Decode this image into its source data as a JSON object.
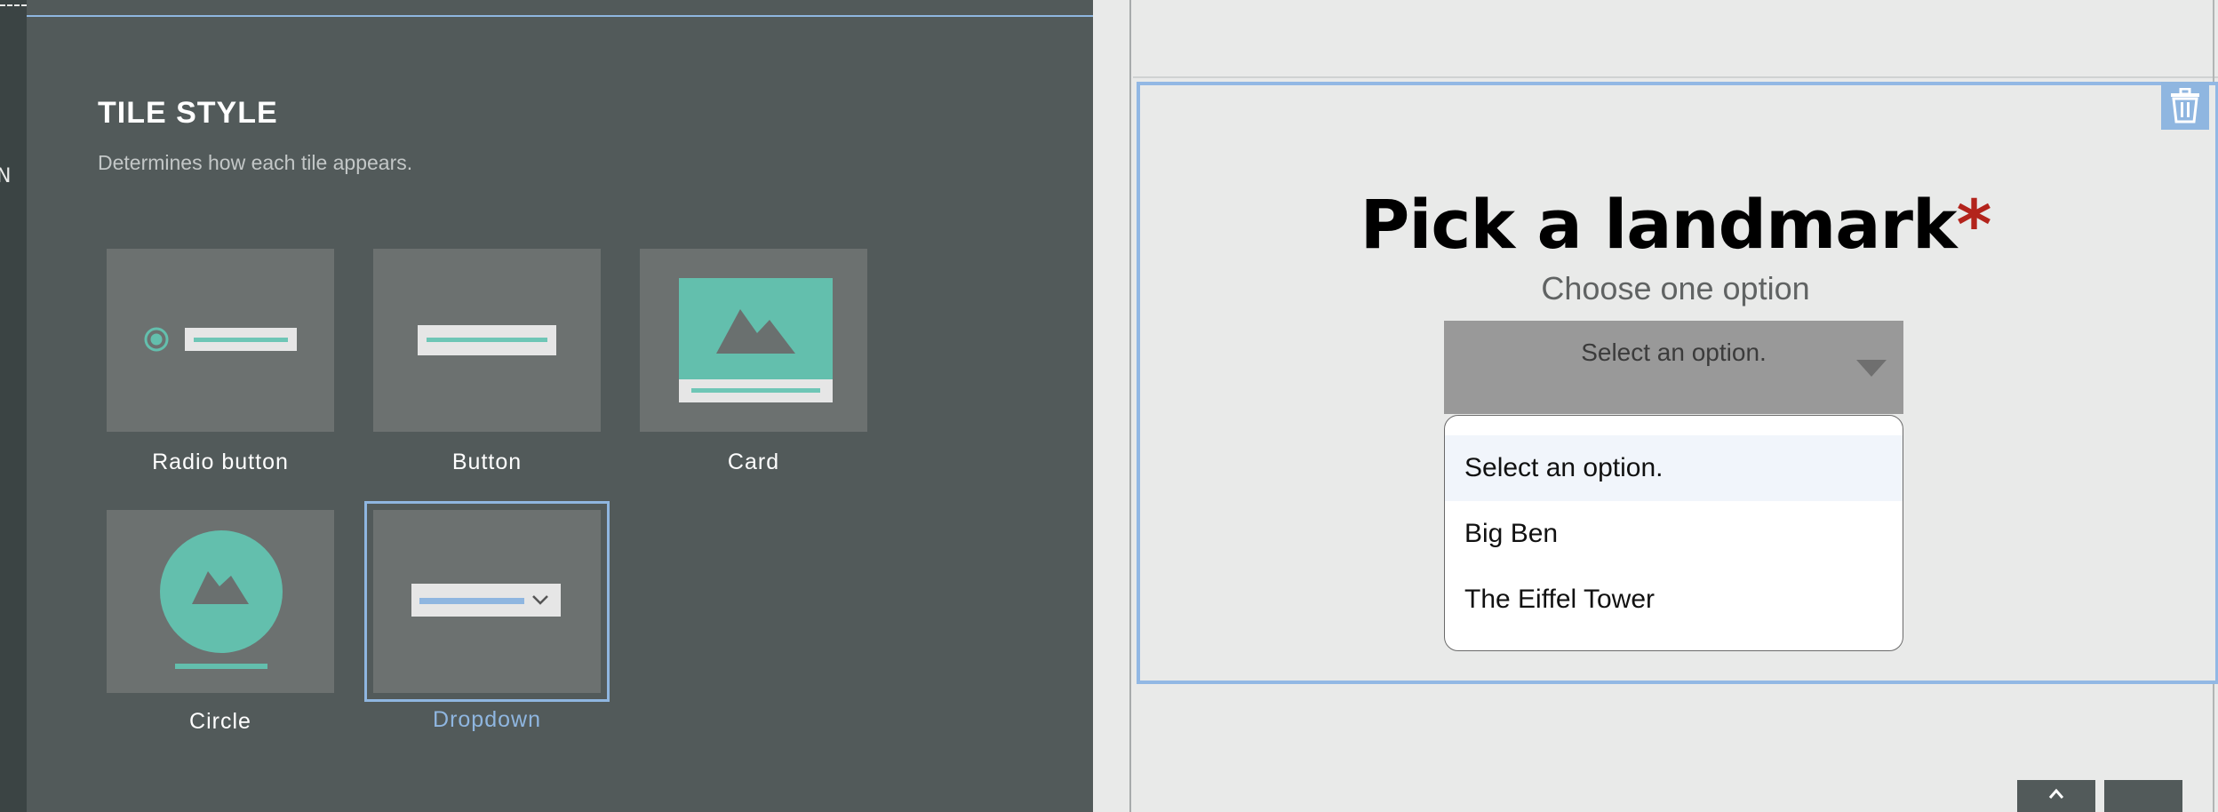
{
  "panel": {
    "title": "TILE STYLE",
    "subtitle": "Determines how each tile appears.",
    "tiles": [
      {
        "label": "Radio button",
        "icon": "radio-button-style-icon"
      },
      {
        "label": "Button",
        "icon": "button-style-icon"
      },
      {
        "label": "Card",
        "icon": "card-style-icon"
      },
      {
        "label": "Circle",
        "icon": "circle-style-icon"
      },
      {
        "label": "Dropdown",
        "icon": "dropdown-style-icon",
        "selected": true
      }
    ]
  },
  "preview": {
    "title": "Pick a landmark",
    "required_mark": "*",
    "subtitle": "Choose one option",
    "select_placeholder": "Select an option.",
    "options": [
      "Select an option.",
      "Big Ben",
      "The Eiffel Tower"
    ],
    "highlighted_option": "Select an option."
  },
  "colors": {
    "accent": "#8fb6e0",
    "teal": "#63bfad",
    "panel_bg": "#525a5a",
    "tile_bg": "#6c7170",
    "required": "#b3241c"
  }
}
